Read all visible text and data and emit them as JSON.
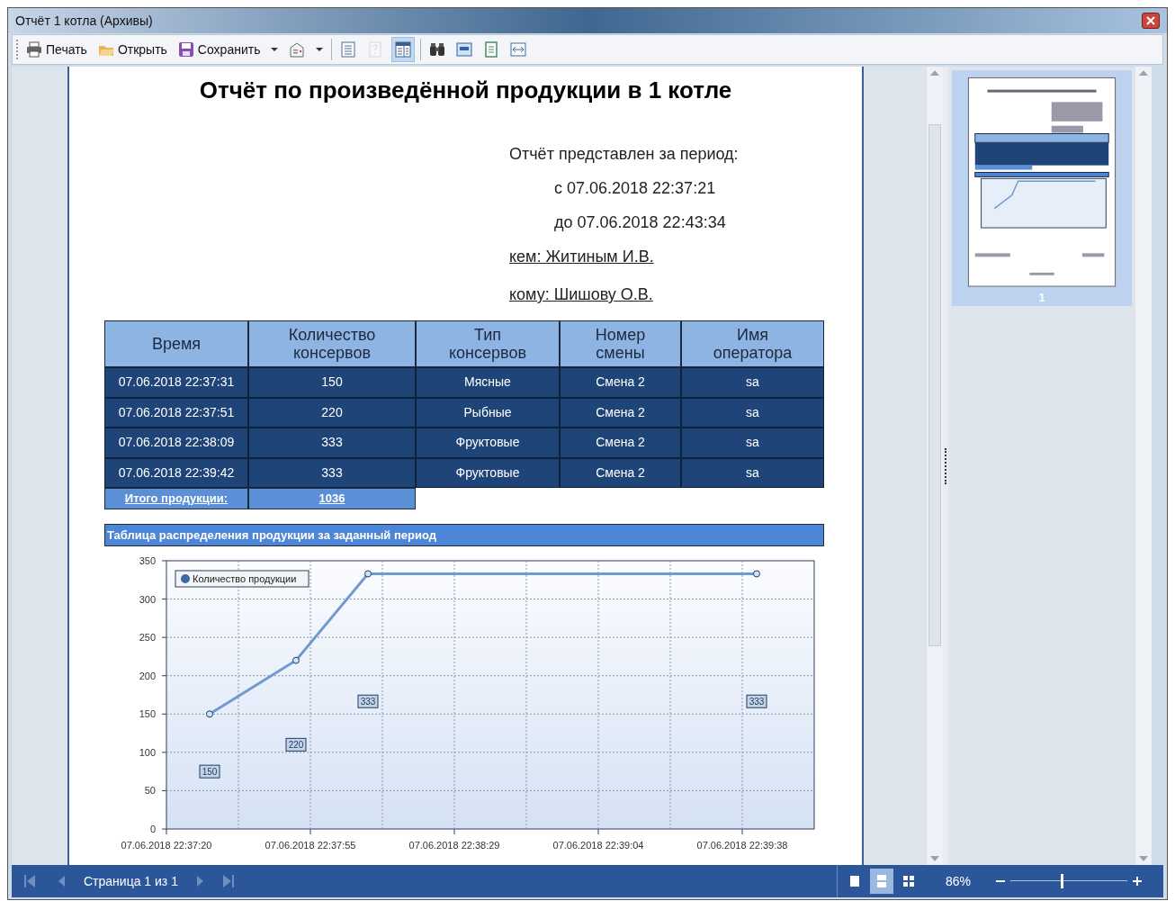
{
  "window": {
    "title": "Отчёт 1 котла (Архивы)"
  },
  "toolbar": [
    {
      "kind": "print",
      "label": "Печать"
    },
    {
      "kind": "open",
      "label": "Открыть"
    },
    {
      "kind": "save",
      "label": "Сохранить"
    },
    {
      "kind": "caret"
    },
    {
      "kind": "export"
    },
    {
      "kind": "caret"
    },
    {
      "kind": "separator"
    },
    {
      "kind": "list",
      "selected": false,
      "disabled": false
    },
    {
      "kind": "help",
      "selected": false,
      "disabled": true
    },
    {
      "kind": "layout",
      "selected": true,
      "disabled": false
    },
    {
      "kind": "separator"
    },
    {
      "kind": "find",
      "selected": false,
      "disabled": false
    },
    {
      "kind": "page",
      "selected": false,
      "disabled": false
    },
    {
      "kind": "pagegreen",
      "selected": false,
      "disabled": false
    },
    {
      "kind": "fit",
      "selected": false,
      "disabled": false
    }
  ],
  "report": {
    "title": "Отчёт по произведённой продукции в 1 котле",
    "period_label": "Отчёт представлен за период:",
    "period_from": "с 07.06.2018 22:37:21",
    "period_to": "до 07.06.2018 22:43:34",
    "by": "кем: Житиным И.В.",
    "to": "кому: Шишову О.В.",
    "table": {
      "columns": [
        "Время",
        "Количество консервов",
        "Тип консервов",
        "Номер смены",
        "Имя оператора"
      ],
      "rows": [
        [
          "07.06.2018 22:37:31",
          "150",
          "Мясные",
          "Смена 2",
          "sa"
        ],
        [
          "07.06.2018 22:37:51",
          "220",
          "Рыбные",
          "Смена 2",
          "sa"
        ],
        [
          "07.06.2018 22:38:09",
          "333",
          "Фруктовые",
          "Смена 2",
          "sa"
        ],
        [
          "07.06.2018 22:39:42",
          "333",
          "Фруктовые",
          "Смена 2",
          "sa"
        ]
      ],
      "total": {
        "label": "Итого продукции:",
        "value": "1036"
      }
    },
    "chart_title": "Таблица распределения продукции за заданный период",
    "chart_data": {
      "type": "line",
      "categories": [
        "07.06.2018 22:37:20",
        null,
        null,
        null,
        null,
        null,
        null,
        null,
        null,
        null,
        "07.06.2018 22:37:55",
        null,
        null,
        null,
        null,
        null,
        null,
        null,
        null,
        null,
        "07.06.2018 22:38:29",
        null,
        null,
        null,
        null,
        null,
        null,
        null,
        null,
        null,
        "07.06.2018 22:39:04",
        null,
        null,
        null,
        null,
        null,
        null,
        null,
        null,
        null,
        "07.06.2018 22:39:38",
        null,
        null,
        null,
        null,
        null
      ],
      "grid": true,
      "series": [
        {
          "name": "Количество продукции",
          "color": "#6f9ad0",
          "marker": "circle",
          "values": [
            null,
            null,
            null,
            150,
            null,
            null,
            null,
            null,
            null,
            220,
            null,
            null,
            null,
            null,
            333,
            null,
            null,
            null,
            null,
            null,
            null,
            null,
            null,
            null,
            null,
            null,
            null,
            null,
            null,
            null,
            null,
            null,
            null,
            null,
            null,
            null,
            null,
            null,
            null,
            null,
            null,
            333,
            null,
            null,
            null,
            null
          ]
        }
      ],
      "ylim": [
        0,
        350
      ],
      "yticks": [
        0,
        50,
        100,
        150,
        200,
        250,
        300,
        350
      ],
      "value_labels": [
        null,
        null,
        null,
        "150",
        null,
        null,
        null,
        null,
        null,
        "220",
        null,
        null,
        null,
        null,
        "333",
        null,
        null,
        null,
        null,
        null,
        null,
        null,
        null,
        null,
        null,
        null,
        null,
        null,
        null,
        null,
        null,
        null,
        null,
        null,
        null,
        null,
        null,
        null,
        null,
        null,
        null,
        "333",
        null,
        null,
        null,
        null
      ]
    }
  },
  "thumbnail": {
    "page": "1",
    "selected": true
  },
  "status_bar": {
    "page_text": "Страница 1 из 1",
    "view_modes": [
      {
        "kind": "single",
        "selected": false
      },
      {
        "kind": "continuous",
        "selected": true
      },
      {
        "kind": "multi",
        "selected": false
      }
    ],
    "zoom": "86%",
    "zoom_slider": {
      "level": 0.44
    }
  }
}
